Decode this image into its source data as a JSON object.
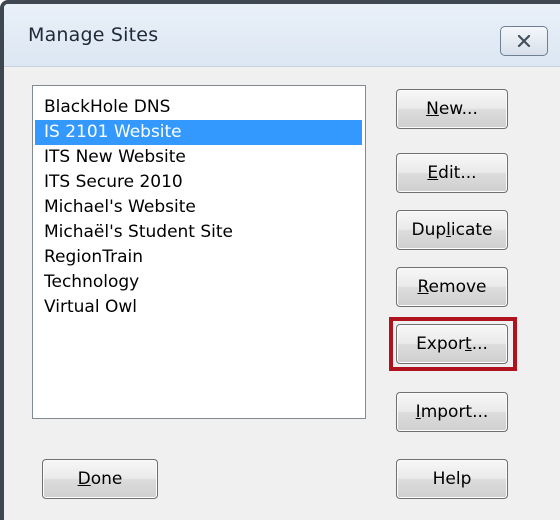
{
  "window": {
    "title": "Manage Sites",
    "close_icon": "close-x-icon"
  },
  "sites": {
    "items": [
      "BlackHole DNS",
      "IS 2101 Website",
      "ITS New Website",
      "ITS Secure 2010",
      "Michael's Website",
      "Michaël's Student Site",
      "RegionTrain",
      "Technology",
      "Virtual Owl"
    ],
    "selected_index": 1
  },
  "buttons": {
    "new": {
      "pre": "",
      "key": "N",
      "post": "ew..."
    },
    "edit": {
      "pre": "",
      "key": "E",
      "post": "dit..."
    },
    "duplicate": {
      "pre": "Dup",
      "key": "l",
      "post": "icate"
    },
    "remove": {
      "pre": "",
      "key": "R",
      "post": "emove"
    },
    "export": {
      "pre": "Expor",
      "key": "t",
      "post": "..."
    },
    "import": {
      "pre": "",
      "key": "I",
      "post": "mport..."
    },
    "done": {
      "pre": "",
      "key": "D",
      "post": "one"
    },
    "help": {
      "pre": "Help",
      "key": "",
      "post": ""
    }
  },
  "colors": {
    "selection": "#3399ff",
    "highlight_border": "#b0121e"
  }
}
